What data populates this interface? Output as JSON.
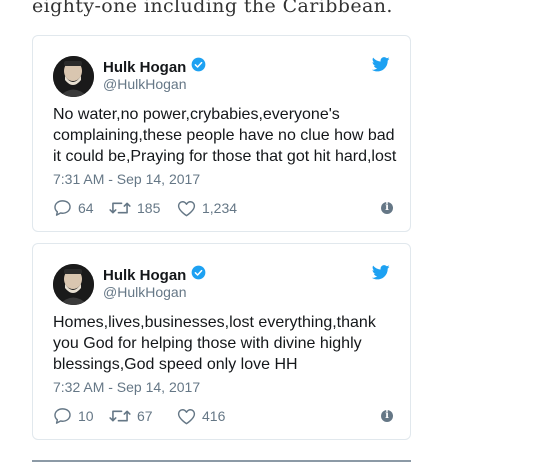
{
  "article": {
    "text_fragment": "eighty-one including the Caribbean."
  },
  "colors": {
    "twitter_blue": "#1da1f2",
    "secondary_text": "#657786",
    "border": "#e1e8ed"
  },
  "tweets": [
    {
      "display_name": "Hulk Hogan",
      "handle": "@HulkHogan",
      "verified": true,
      "text_lines": [
        "No water,no power,crybabies,everyone's",
        "complaining,these people have no clue how bad",
        "it could be,Praying for those that got hit hard,lost"
      ],
      "timestamp": "7:31 AM - Sep 14, 2017",
      "replies": "64",
      "retweets": "185",
      "likes": "1,234"
    },
    {
      "display_name": "Hulk Hogan",
      "handle": "@HulkHogan",
      "verified": true,
      "text_lines": [
        "Homes,lives,businesses,lost everything,thank",
        "you God for helping those with divine highly",
        "blessings,God speed only love HH"
      ],
      "timestamp": "7:32 AM - Sep 14, 2017",
      "replies": "10",
      "retweets": "67",
      "likes": "416"
    }
  ],
  "icons": {
    "verified": "verified-badge-icon",
    "bird": "twitter-bird-icon",
    "reply": "reply-icon",
    "retweet": "retweet-icon",
    "like": "heart-icon",
    "info": "info-icon"
  }
}
